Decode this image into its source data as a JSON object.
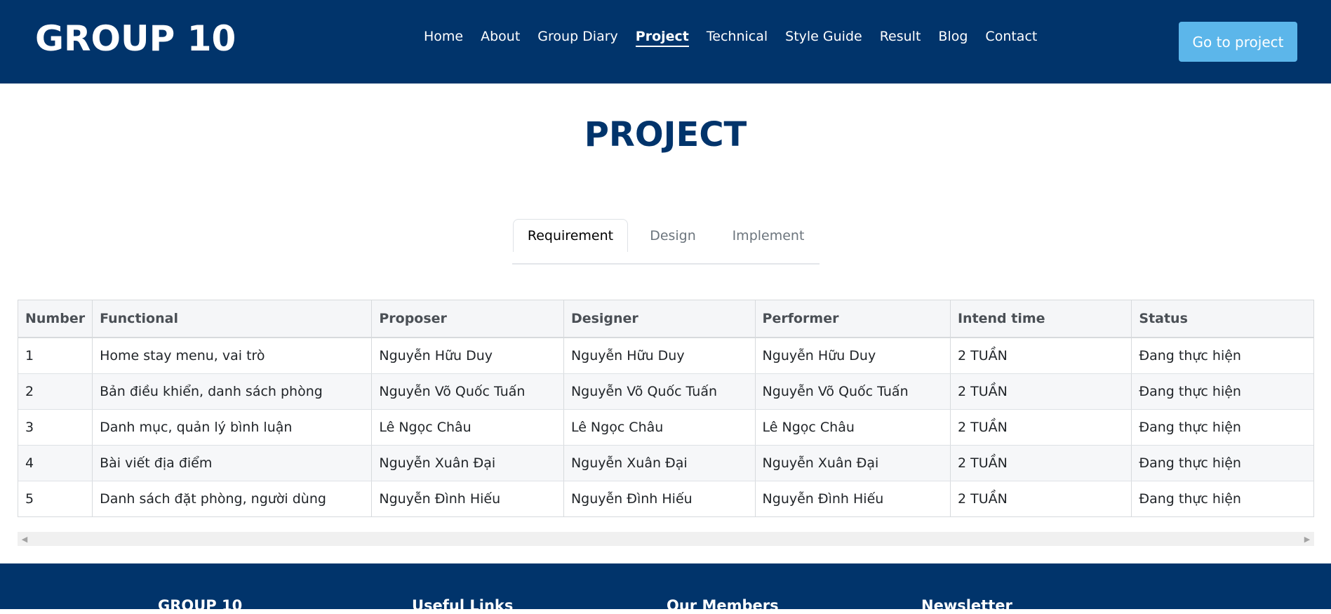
{
  "header": {
    "logo": "GROUP 10",
    "nav": [
      {
        "label": "Home"
      },
      {
        "label": "About"
      },
      {
        "label": "Group Diary"
      },
      {
        "label": "Project",
        "active": true
      },
      {
        "label": "Technical"
      },
      {
        "label": "Style Guide"
      },
      {
        "label": "Result"
      },
      {
        "label": "Blog"
      },
      {
        "label": "Contact"
      }
    ],
    "cta_label": "Go to project"
  },
  "main": {
    "title": "PROJECT",
    "tabs": [
      {
        "label": "Requirement",
        "active": true
      },
      {
        "label": "Design"
      },
      {
        "label": "Implement"
      }
    ],
    "table": {
      "columns": [
        "Number",
        "Functional",
        "Proposer",
        "Designer",
        "Performer",
        "Intend time",
        "Status"
      ],
      "rows": [
        [
          "1",
          "Home stay menu, vai trò",
          "Nguyễn Hữu Duy",
          "Nguyễn Hữu Duy",
          "Nguyễn Hữu Duy",
          "2 TUẦN",
          "Đang thực hiện"
        ],
        [
          "2",
          "Bản điều khiển, danh sách phòng",
          "Nguyễn Võ Quốc Tuấn",
          "Nguyễn Võ Quốc Tuấn",
          "Nguyễn Võ Quốc Tuấn",
          "2 TUẦN",
          "Đang thực hiện"
        ],
        [
          "3",
          "Danh mục, quản lý bình luận",
          "Lê Ngọc Châu",
          "Lê Ngọc Châu",
          "Lê Ngọc Châu",
          "2 TUẦN",
          "Đang thực hiện"
        ],
        [
          "4",
          "Bài viết địa điểm",
          "Nguyễn Xuân Đại",
          "Nguyễn Xuân Đại",
          "Nguyễn Xuân Đại",
          "2 TUẦN",
          "Đang thực hiện"
        ],
        [
          "5",
          "Danh sách đặt phòng, người dùng",
          "Nguyễn Đình Hiếu",
          "Nguyễn Đình Hiếu",
          "Nguyễn Đình Hiếu",
          "2 TUẦN",
          "Đang thực hiện"
        ]
      ]
    },
    "scrollbar": {
      "left_icon": "scroll-left-arrow-icon",
      "right_icon": "scroll-right-arrow-icon"
    }
  },
  "footer": {
    "columns": [
      "GROUP 10",
      "Useful Links",
      "Our Members",
      "Newsletter"
    ]
  },
  "colors": {
    "brand": "#01346b",
    "accent": "#5cb6ea"
  }
}
